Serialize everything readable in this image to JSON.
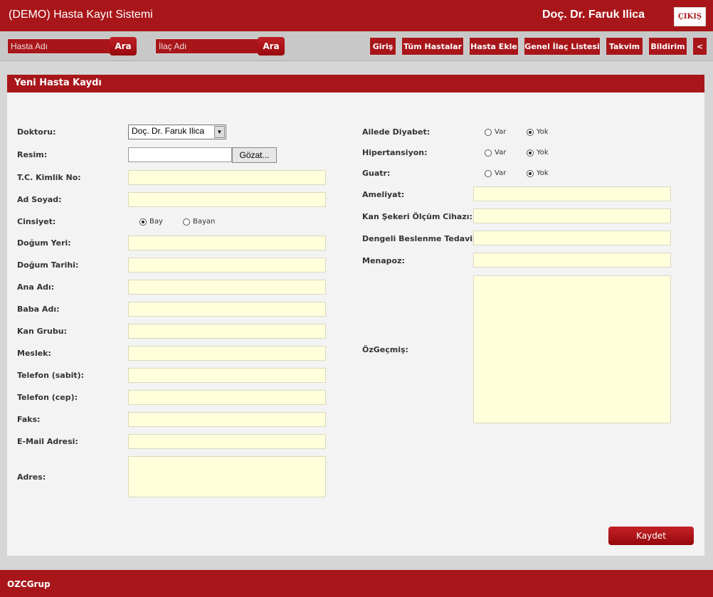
{
  "header": {
    "title": "(DEMO) Hasta Kayıt Sistemi",
    "user": "Doç. Dr. Faruk Ilica",
    "logout": "ÇIKIŞ"
  },
  "search": {
    "patient_placeholder": "Hasta Adı",
    "drug_placeholder": "İlaç Adı",
    "search_button": "Ara"
  },
  "nav": [
    {
      "label": "Giriş"
    },
    {
      "label": "Tüm Hastalar"
    },
    {
      "label": "Hasta Ekle"
    },
    {
      "label": "Genel İlaç Listesi"
    },
    {
      "label": "Takvim"
    },
    {
      "label": "Bildirim"
    },
    {
      "label": "<"
    }
  ],
  "form": {
    "title": "Yeni Hasta Kaydı",
    "doctor_label": "Doktoru:",
    "doctor_value": "Doç. Dr. Faruk Ilica",
    "photo_label": "Resim:",
    "browse": "Gözat...",
    "tc_label": "T.C. Kimlik No:",
    "name_label": "Ad Soyad:",
    "gender_label": "Cinsiyet:",
    "gender_options": [
      "Bay",
      "Bayan"
    ],
    "gender_selected": "Bay",
    "birthplace_label": "Doğum Yeri:",
    "birthdate_label": "Doğum Tarihi:",
    "mother_label": "Ana Adı:",
    "father_label": "Baba Adı:",
    "blood_label": "Kan Grubu:",
    "job_label": "Meslek:",
    "phone_label": "Telefon (sabit):",
    "mobile_label": "Telefon (cep):",
    "fax_label": "Faks:",
    "email_label": "E-Mail Adresi:",
    "address_label": "Adres:",
    "diabetes_label": "Ailede Diyabet:",
    "hypertension_label": "Hipertansiyon:",
    "goiter_label": "Guatr:",
    "yes": "Var",
    "no": "Yok",
    "surgery_label": "Ameliyat:",
    "glucometer_label": "Kan Şekeri Ölçüm Cihazı:",
    "diet_label": "Dengeli Beslenme Tedavisi:",
    "menopause_label": "Menapoz:",
    "bio_label": "ÖzGeçmiş:",
    "save": "Kaydet"
  },
  "footer": {
    "text": "OZCGrup"
  },
  "colors": {
    "brand": "#a8161a",
    "field_bg": "#ffffdc",
    "panel_bg": "#f3f3f3"
  }
}
